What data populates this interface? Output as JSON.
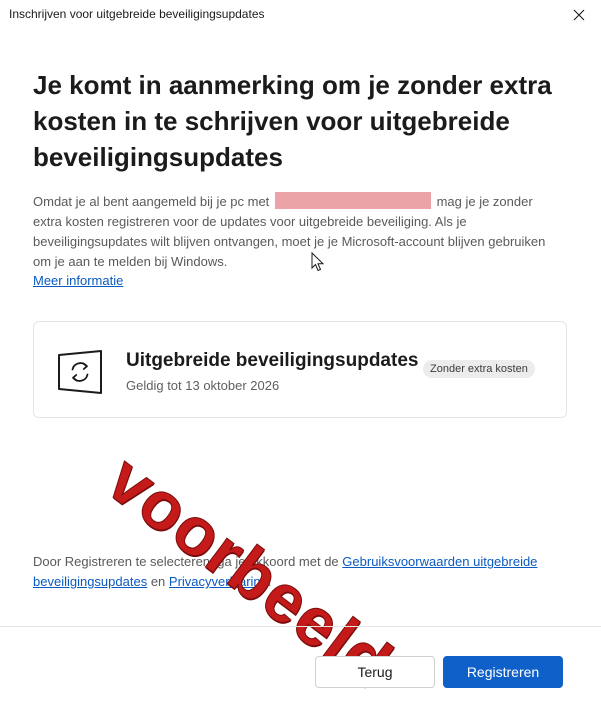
{
  "window": {
    "title": "Inschrijven voor uitgebreide beveiligingsupdates",
    "close_icon": "close-icon"
  },
  "heading": "Je komt in aanmerking om je zonder extra kosten in te schrijven voor uitgebreide beveiligingsupdates",
  "intro": {
    "part1": "Omdat je al bent aangemeld bij je pc met",
    "redacted": "",
    "part2": "mag je je zonder extra kosten registreren voor de updates voor uitgebreide beveiliging. Als je beveiligingsupdates wilt blijven ontvangen, moet je je Microsoft-account blijven gebruiken om je aan te melden bij Windows.",
    "more_info_link": "Meer informatie"
  },
  "card": {
    "icon": "windows-update-icon",
    "title": "Uitgebreide beveiligingsupdates",
    "subtitle": "Geldig tot 13 oktober 2026",
    "badge": "Zonder extra kosten"
  },
  "watermark": "voorbeeld",
  "legal": {
    "part1": "Door Registreren te selecteren, ga je akkoord met de",
    "terms_link": "Gebruiksvoorwaarden uitgebreide beveiligingsupdates",
    "part2": "en",
    "privacy_link": "Privacyverklaring",
    "part3": "."
  },
  "buttons": {
    "back": "Terug",
    "register": "Registreren"
  },
  "colors": {
    "accent": "#0f60c8",
    "link": "#0a5ac2",
    "watermark": "#c41a1a",
    "redaction": "#eba3a7"
  }
}
